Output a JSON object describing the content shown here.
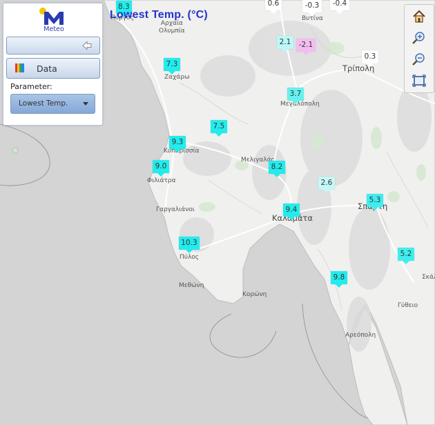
{
  "map": {
    "title": "Lowest Temp. (°C)",
    "colors": {
      "land": "#f0f0ef",
      "sea": "#d4d4d4",
      "road": "#ffffff",
      "coast": "#bdbdbd",
      "text": "#555555"
    },
    "places": [
      {
        "id": "pyrgos",
        "name": "Πύργος",
        "big": false
      },
      {
        "id": "archaia-olympia",
        "name": "Αρχαία\nΟλυμπία",
        "big": false
      },
      {
        "id": "vytina",
        "name": "Βυτίνα",
        "big": false
      },
      {
        "id": "tripoli",
        "name": "Τρίπολη",
        "big": true
      },
      {
        "id": "zacharo",
        "name": "Ζαχάρω",
        "big": false
      },
      {
        "id": "megalopoli",
        "name": "Μεγαλόπολη",
        "big": false
      },
      {
        "id": "kyparissia",
        "name": "Κυπαρισσία",
        "big": false
      },
      {
        "id": "meligalas",
        "name": "Μελιγαλάς",
        "big": false
      },
      {
        "id": "filiatra",
        "name": "Φιλιάτρα",
        "big": false
      },
      {
        "id": "gargalianoi",
        "name": "Γαργαλιάνοι",
        "big": false
      },
      {
        "id": "sparti",
        "name": "Σπάρτη",
        "big": true
      },
      {
        "id": "kalamata",
        "name": "Καλαμάτα",
        "big": true
      },
      {
        "id": "pylos",
        "name": "Πύλος",
        "big": false
      },
      {
        "id": "skala",
        "name": "Σκάλα",
        "big": false
      },
      {
        "id": "methoni",
        "name": "Μεθώνη",
        "big": false
      },
      {
        "id": "koroni",
        "name": "Κορώνη",
        "big": false
      },
      {
        "id": "gytheio",
        "name": "Γύθειο",
        "big": false
      },
      {
        "id": "areopoli",
        "name": "Αρεόπολη",
        "big": false
      }
    ],
    "markers": [
      {
        "value": "8.3",
        "color": "#22ecec"
      },
      {
        "value": "0.6",
        "color": "#ffffff"
      },
      {
        "value": "-0.3",
        "color": "#ffffff"
      },
      {
        "value": "-0.4",
        "color": "#ffffff"
      },
      {
        "value": "2.1",
        "color": "#bdf7f7"
      },
      {
        "value": "-2.1",
        "color": "#f3bdf0"
      },
      {
        "value": "0.3",
        "color": "#ffffff"
      },
      {
        "value": "7.3",
        "color": "#22ecec"
      },
      {
        "value": "3.7",
        "color": "#66f0f0"
      },
      {
        "value": "7.5",
        "color": "#22ecec"
      },
      {
        "value": "9.3",
        "color": "#22ecec"
      },
      {
        "value": "9.0",
        "color": "#22ecec"
      },
      {
        "value": "8.2",
        "color": "#22ecec"
      },
      {
        "value": "2.6",
        "color": "#c6f7f7"
      },
      {
        "value": "5.3",
        "color": "#3eeeee"
      },
      {
        "value": "9.4",
        "color": "#22ecec"
      },
      {
        "value": "10.3",
        "color": "#22ecec"
      },
      {
        "value": "5.2",
        "color": "#3eeeee"
      },
      {
        "value": "9.8",
        "color": "#22ecec"
      }
    ]
  },
  "panel": {
    "logo_text": "Meteo",
    "data_label": "Data",
    "parameter_label": "Parameter:",
    "parameter_value": "Lowest Temp.",
    "colors": {
      "logo": "#2a3cb0",
      "logo_sun": "#f2c500",
      "button_border": "#7f9ab9",
      "select": "#8fb0dc"
    }
  },
  "toolbar": {
    "items": [
      {
        "name": "home-button",
        "icon": "home-icon"
      },
      {
        "name": "zoom-in-button",
        "icon": "zoom-in-icon"
      },
      {
        "name": "zoom-out-button",
        "icon": "zoom-out-icon"
      },
      {
        "name": "full-extent-button",
        "icon": "full-extent-icon"
      }
    ]
  }
}
